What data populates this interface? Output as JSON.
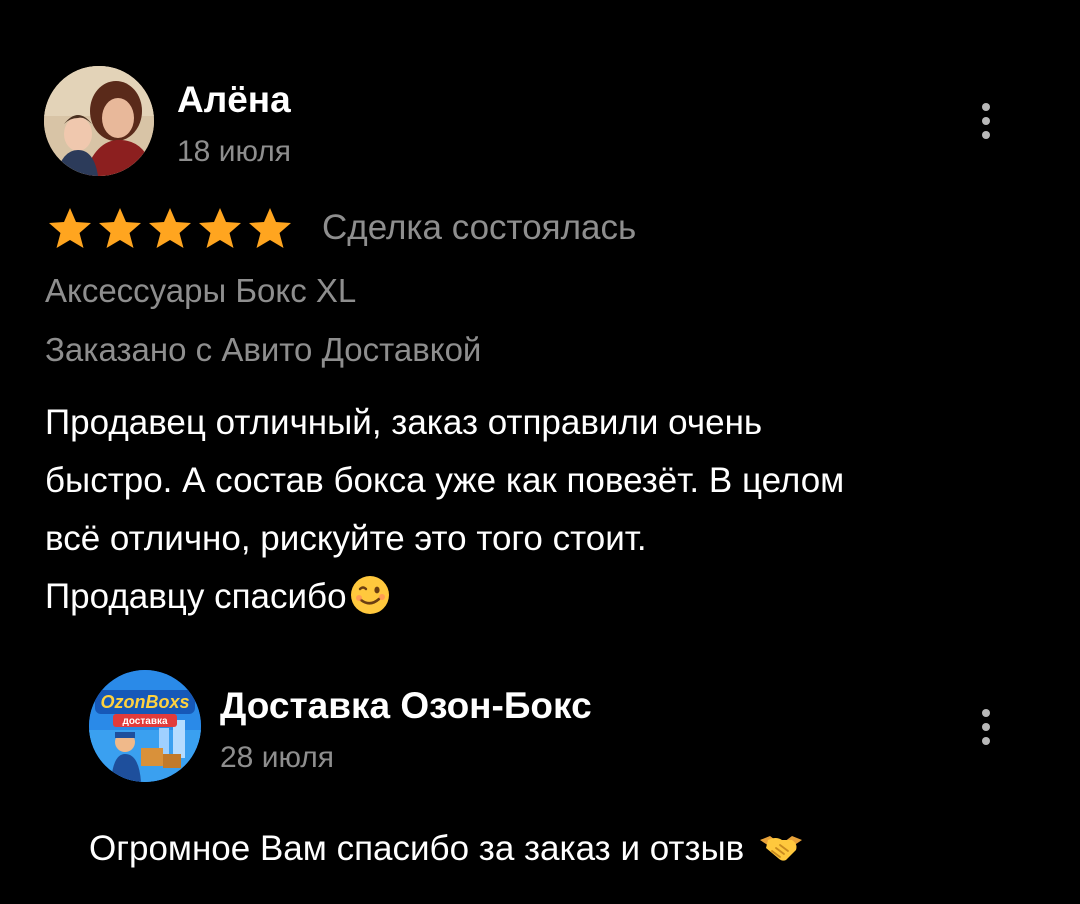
{
  "review": {
    "author_name": "Алёна",
    "date": "18 июля",
    "rating": 5,
    "max_rating": 5,
    "deal_status": "Сделка состоялась",
    "product": "Аксессуары Бокс XL",
    "delivery_note": "Заказано с Авито Доставкой",
    "text_lines": [
      "Продавец отличный,  заказ отправили очень",
      "быстро. А состав бокса уже как повезёт. В целом",
      "всё отлично, рискуйте это того стоит.",
      "Продавцу спасибо"
    ],
    "text_emoji": "winking-face-emoji"
  },
  "reply": {
    "author_name": "Доставка Озон-Бокс",
    "date": "28 июля",
    "text": "Огромное Вам спасибо за заказ и отзыв",
    "text_emoji": "handshake-emoji",
    "logo_text_top": "OzonBoxs",
    "logo_text_bottom": "доставка"
  },
  "colors": {
    "background": "#000000",
    "primary_text": "#ffffff",
    "secondary_text": "#8e8e8e",
    "star": "#ffa51f",
    "menu_dots": "#b8b8b8"
  },
  "icons": {
    "review_menu": "more-vertical-icon",
    "reply_menu": "more-vertical-icon",
    "star": "star-icon"
  }
}
